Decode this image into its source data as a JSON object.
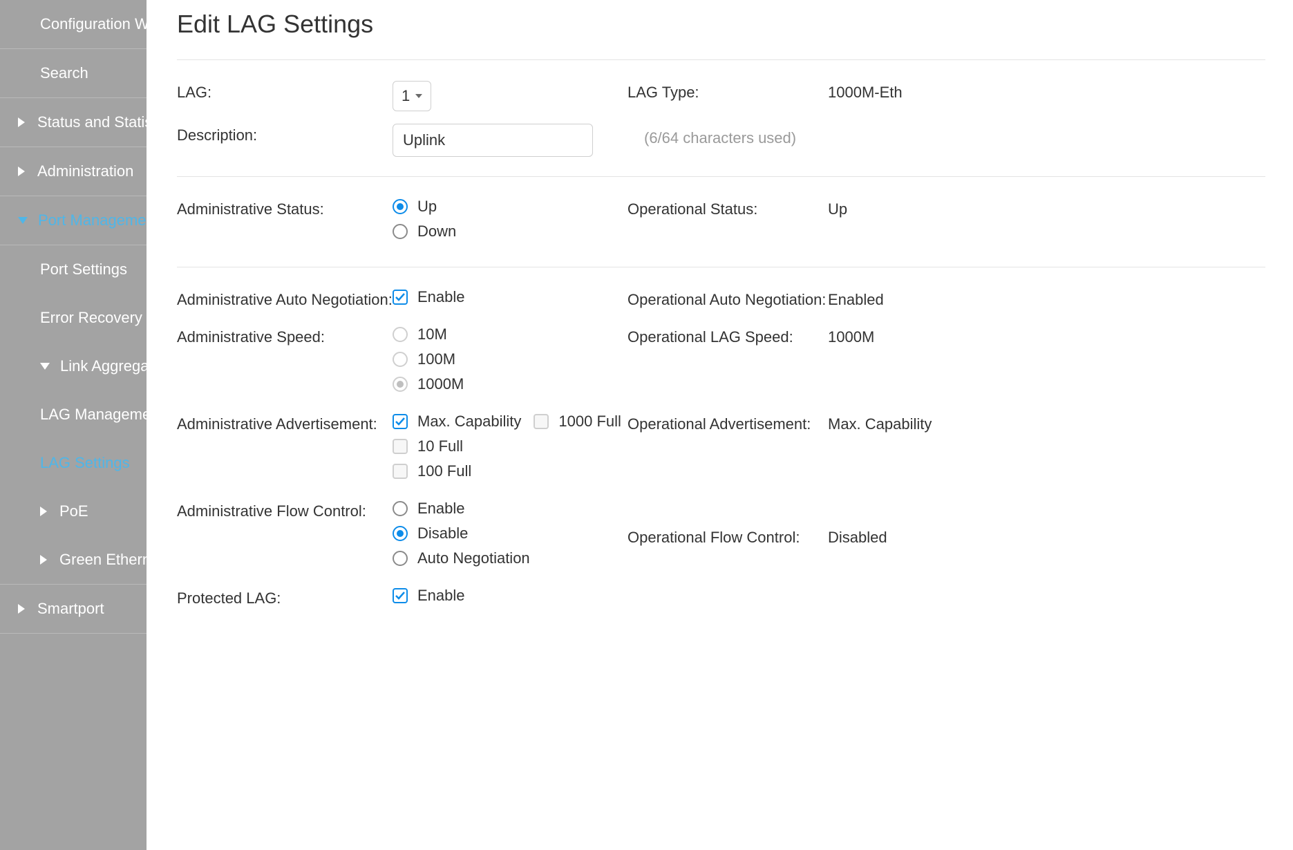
{
  "sidebar": {
    "configuration": "Configuration Wizards",
    "search": "Search",
    "status": "Status and Statistics",
    "administration": "Administration",
    "port_mgmt": "Port Management",
    "port_settings": "Port Settings",
    "error_recovery": "Error Recovery Settings",
    "link_agg": "Link Aggregation",
    "lag_mgmt": "LAG Management",
    "lag_settings": "LAG Settings",
    "poe": "PoE",
    "green_eth": "Green Ethernet",
    "smartport": "Smartport"
  },
  "page": {
    "title": "Edit LAG Settings"
  },
  "labels": {
    "lag": "LAG:",
    "lag_type": "LAG Type:",
    "description": "Description:",
    "admin_status": "Administrative Status:",
    "oper_status": "Operational Status:",
    "admin_auto_neg": "Administrative Auto Negotiation:",
    "oper_auto_neg": "Operational Auto Negotiation:",
    "admin_speed": "Administrative Speed:",
    "oper_lag_speed": "Operational LAG Speed:",
    "admin_adv": "Administrative Advertisement:",
    "oper_adv": "Operational Advertisement:",
    "admin_flow": "Administrative Flow Control:",
    "oper_flow": "Operational Flow Control:",
    "protected_lag": "Protected LAG:"
  },
  "values": {
    "lag_selected": "1",
    "lag_type": "1000M-Eth",
    "description": "Uplink",
    "desc_hint": "(6/64 characters used)",
    "oper_status": "Up",
    "oper_auto_neg": "Enabled",
    "oper_lag_speed": "1000M",
    "oper_adv": "Max. Capability",
    "oper_flow": "Disabled"
  },
  "options": {
    "admin_status": {
      "up": "Up",
      "down": "Down"
    },
    "enable": "Enable",
    "speed": {
      "m10": "10M",
      "m100": "100M",
      "m1000": "1000M"
    },
    "adv": {
      "max": "Max. Capability",
      "f1000": "1000 Full",
      "f10": "10 Full",
      "f100": "100 Full"
    },
    "flow": {
      "enable": "Enable",
      "disable": "Disable",
      "auto": "Auto Negotiation"
    }
  }
}
